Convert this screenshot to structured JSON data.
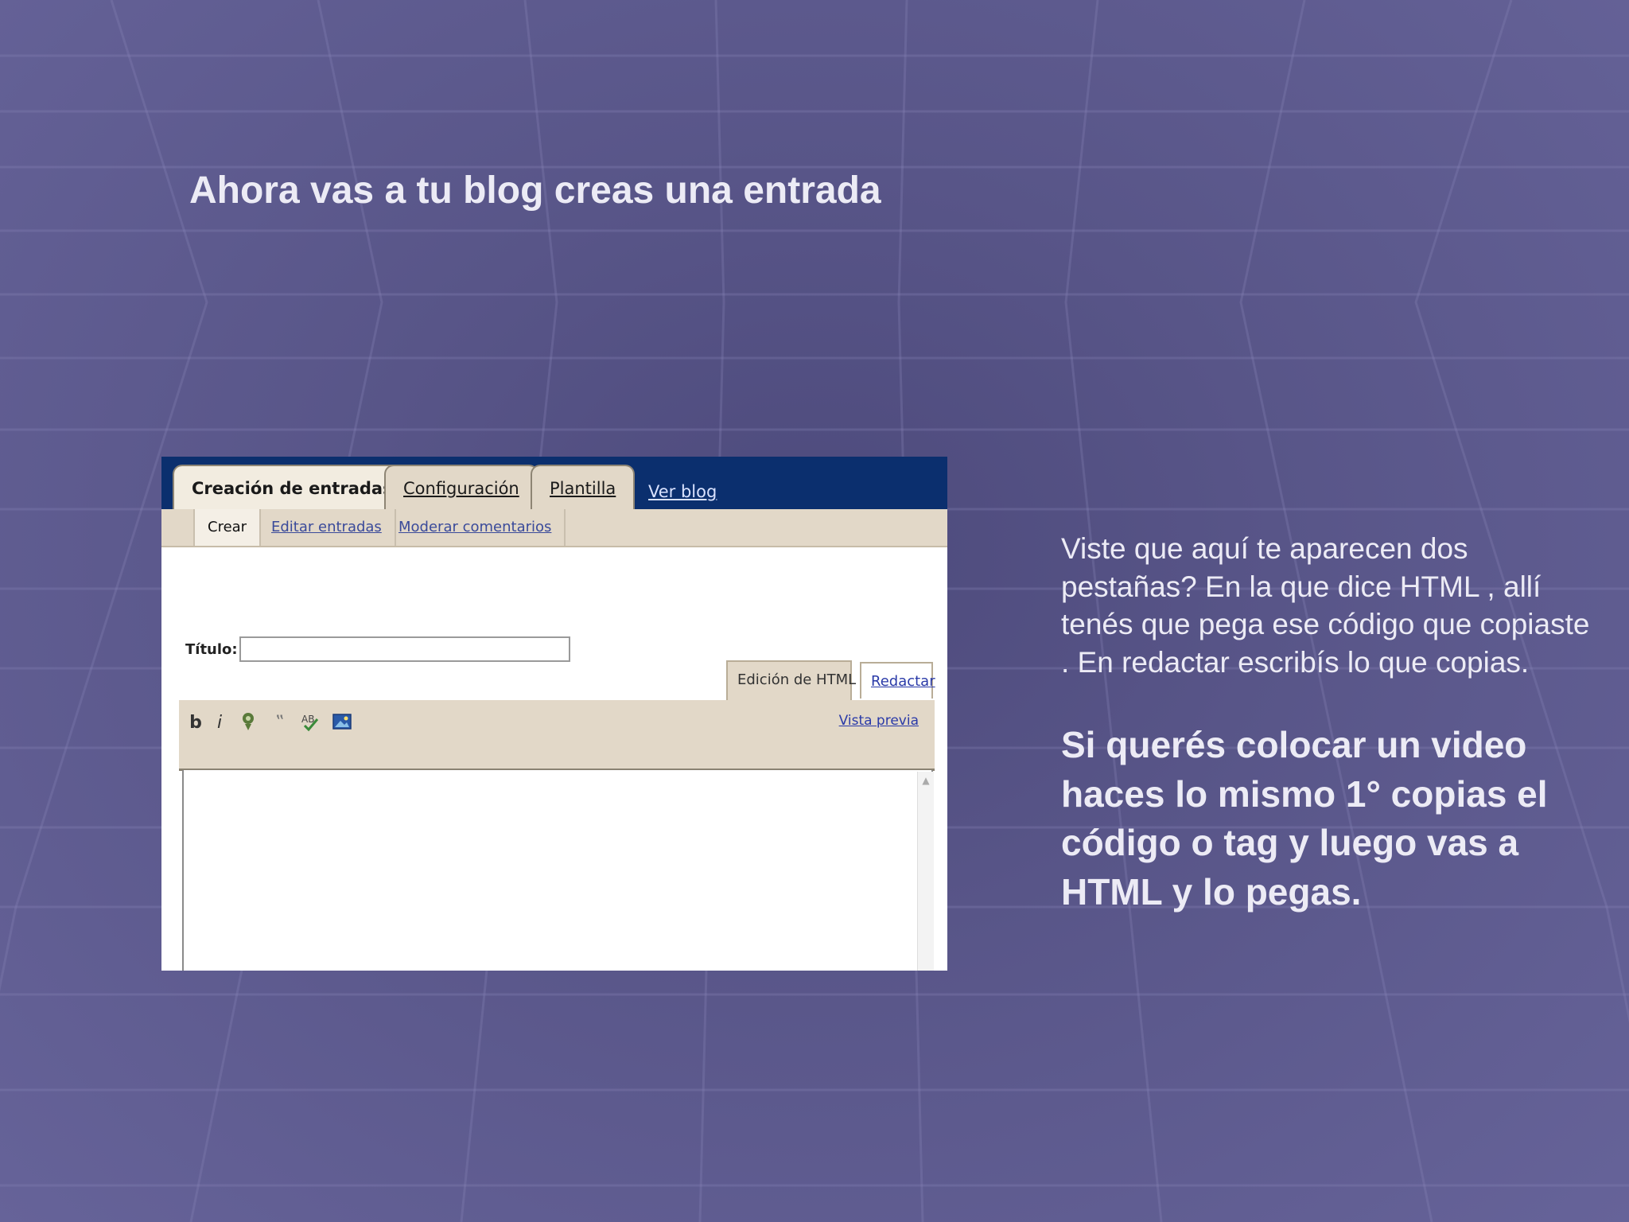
{
  "slide": {
    "title": "Ahora vas a tu blog creas una entrada",
    "description": "Viste que aquí te aparecen dos pestañas? En la que dice HTML , allí tenés que pega ese código que copiaste . En redactar escribís lo que copias.",
    "instruction": "Si querés colocar un video haces lo mismo 1° copias el código o tag y luego vas a HTML y lo pegas."
  },
  "screenshot": {
    "main_tabs": [
      {
        "label": "Creación de entradas",
        "active": true
      },
      {
        "label": "Configuración",
        "active": false
      },
      {
        "label": "Plantilla",
        "active": false
      }
    ],
    "view_blog_link": "Ver blog",
    "sub_tabs": [
      {
        "label": "Crear",
        "active": true
      },
      {
        "label": "Editar entradas",
        "active": false
      },
      {
        "label": "Moderar comentarios",
        "active": false
      }
    ],
    "title_label": "Título:",
    "title_value": "",
    "mode_tabs": {
      "html": "Edición de HTML",
      "compose": "Redactar"
    },
    "toolbar": {
      "bold": "b",
      "italic": "i",
      "link_icon": "link-icon",
      "quote": "‟",
      "spellcheck_icon": "spellcheck-icon",
      "image_icon": "image-icon",
      "preview": "Vista previa"
    },
    "editor_value": "",
    "colors": {
      "topbar": "#0b2f6e",
      "panel": "#e2d8c8",
      "link": "#2a3aa8"
    }
  }
}
